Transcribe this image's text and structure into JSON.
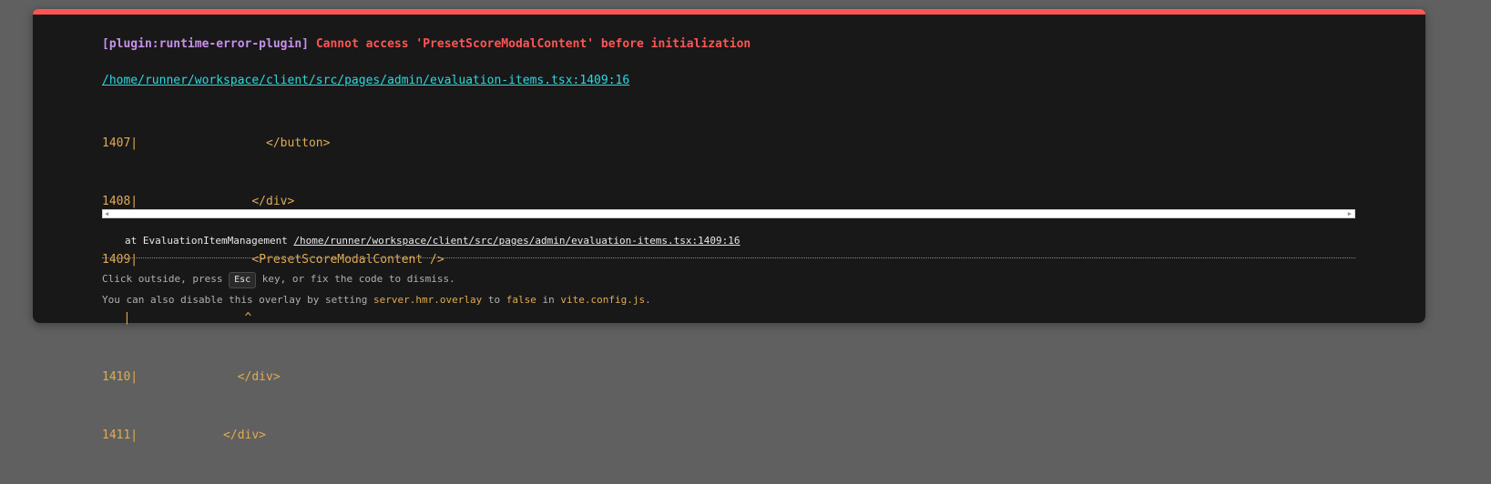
{
  "overlay": {
    "plugin": "[plugin:runtime-error-plugin]",
    "message": "Cannot access 'PresetScoreModalContent' before initialization",
    "file_link": "/home/runner/workspace/client/src/pages/admin/evaluation-items.tsx:1409:16",
    "frame_lines": [
      "1407|                  </button>",
      "1408|                </div>",
      "1409|                <PresetScoreModalContent />",
      "   |                ^",
      "1410|              </div>",
      "1411|            </div>"
    ],
    "stack_prefix": "at EvaluationItemManagement ",
    "stack_link": "/home/runner/workspace/client/src/pages/admin/evaluation-items.tsx:1409:16",
    "tip1": {
      "before": "Click outside, press ",
      "key": "Esc",
      "after": " key, or fix the code to dismiss."
    },
    "tip2": {
      "before": "You can also disable this overlay by setting ",
      "code1": "server.hmr.overlay",
      "mid1": " to ",
      "code2": "false",
      "mid2": " in ",
      "code3": "vite.config.js",
      "after": "."
    }
  },
  "colors": {
    "accent": "#ff5555",
    "plugin": "#c792ea",
    "link": "#2dd9da",
    "code": "#e2aa53",
    "background": "#181818"
  }
}
